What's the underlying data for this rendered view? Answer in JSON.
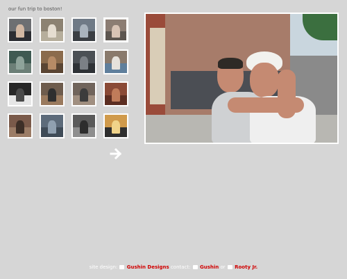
{
  "page": {
    "title": "our fun trip to boston!"
  },
  "gallery": {
    "thumbnails": [
      {
        "name": "photo-1",
        "c1": "#6d6f72",
        "c2": "#2d2e33",
        "c3": "#d2b7a2"
      },
      {
        "name": "photo-2",
        "c1": "#8c8272",
        "c2": "#b6ae9c",
        "c3": "#e5ddd0"
      },
      {
        "name": "photo-3",
        "c1": "#6f7a86",
        "c2": "#3b3f44",
        "c3": "#a9b3bd"
      },
      {
        "name": "photo-4",
        "c1": "#8c7d73",
        "c2": "#5d5650",
        "c3": "#d8c3b5"
      },
      {
        "name": "photo-5",
        "c1": "#3f5a52",
        "c2": "#6c7f77",
        "c3": "#8ea39a"
      },
      {
        "name": "photo-6",
        "c1": "#8b6b4c",
        "c2": "#5a4533",
        "c3": "#b68b66"
      },
      {
        "name": "photo-7",
        "c1": "#4b5055",
        "c2": "#2e3236",
        "c3": "#7b8086"
      },
      {
        "name": "photo-8",
        "c1": "#8a7a6c",
        "c2": "#5f7f9c",
        "c3": "#e6e2dc"
      },
      {
        "name": "photo-9",
        "c1": "#272727",
        "c2": "#e6e6e6",
        "c3": "#4a4a4a"
      },
      {
        "name": "photo-10",
        "c1": "#6e5c4d",
        "c2": "#9a7a5e",
        "c3": "#2f2f2f"
      },
      {
        "name": "photo-11",
        "c1": "#70645b",
        "c2": "#a08f80",
        "c3": "#3c3c3c"
      },
      {
        "name": "photo-12",
        "c1": "#8a4a36",
        "c2": "#5c2e22",
        "c3": "#c07c5a"
      },
      {
        "name": "photo-13",
        "c1": "#7a5a4a",
        "c2": "#9b7c66",
        "c3": "#3d2f27"
      },
      {
        "name": "photo-14",
        "c1": "#5d6b7a",
        "c2": "#3f4b57",
        "c3": "#90a0b0"
      },
      {
        "name": "photo-15",
        "c1": "#5a5a5a",
        "c2": "#8e8e8e",
        "c3": "#2d2d2d"
      },
      {
        "name": "photo-16",
        "c1": "#d09a4b",
        "c2": "#2f2f2f",
        "c3": "#f0d38a"
      }
    ],
    "selected_index": 3
  },
  "main_photo": {
    "scene_colors": {
      "sky": "#c9d6de",
      "building": "#a77c6a",
      "window": "#4a4a4a",
      "shop": "#4b4e54",
      "pillar": "#d9cdb7",
      "brick": "#9a4b3a",
      "tree": "#3b6f3f",
      "ground": "#b8b7b2",
      "skin": "#c58a72",
      "hat": "#f2f2ee",
      "shirt_gray": "#cfd1d3",
      "shirt_white": "#efefef",
      "hair": "#2e2a26"
    }
  },
  "footer": {
    "prefix": "site design:",
    "designer": "Gushin Designs",
    "contact_label": "contact:",
    "contact_1": "Gushin",
    "or": "or",
    "contact_2": "Rooty Jr."
  },
  "colors": {
    "background": "#d6d6d6",
    "link": "#d10000",
    "border": "#ffffff"
  }
}
